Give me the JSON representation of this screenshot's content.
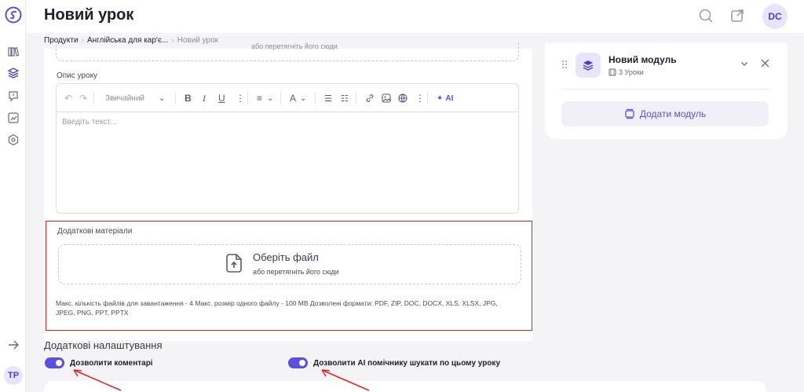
{
  "header": {
    "title": "Новий урок",
    "avatar_initials": "DC",
    "icons": [
      "search-icon",
      "external-link-icon"
    ]
  },
  "rail": {
    "user_initials": "TP",
    "nav_icons": [
      "library-icon",
      "layers-icon",
      "message-icon",
      "chart-icon",
      "settings-icon"
    ]
  },
  "breadcrumb": {
    "items": [
      "Продукти",
      "Англійська для кар'є...",
      "Новий урок"
    ]
  },
  "upload_top": {
    "hint": "або перетягніть його сюди"
  },
  "description": {
    "label": "Опис уроку",
    "style_select": "Звичайний",
    "ai_label": "AI",
    "placeholder": "Введіть текст..."
  },
  "materials": {
    "label": "Додаткові матеріали",
    "choose_file": "Оберіть файл",
    "drag_hint": "або перетягніть його сюди",
    "limits_line1": "Макс. кількість файлів для завантаження - 4 Макс. розмір одного файлу - 100 MB Дозволені формати: PDF, ZIP, DOC, DOCX, XLS, XLSX, JPG,",
    "limits_line2": "JPEG, PNG, PPT, PPTX"
  },
  "settings": {
    "title": "Додаткові налаштування",
    "allow_comments": {
      "label": "Дозволити коментарі",
      "enabled": true
    },
    "allow_ai": {
      "label": "Дозволити AI помічнику шукати по цьому уроку",
      "enabled": true
    }
  },
  "module": {
    "title": "Новий модуль",
    "lessons": "3 Уроки",
    "add_button": "Додати модуль"
  },
  "colors": {
    "accent": "#5b4fe0",
    "highlight": "#e02424"
  }
}
